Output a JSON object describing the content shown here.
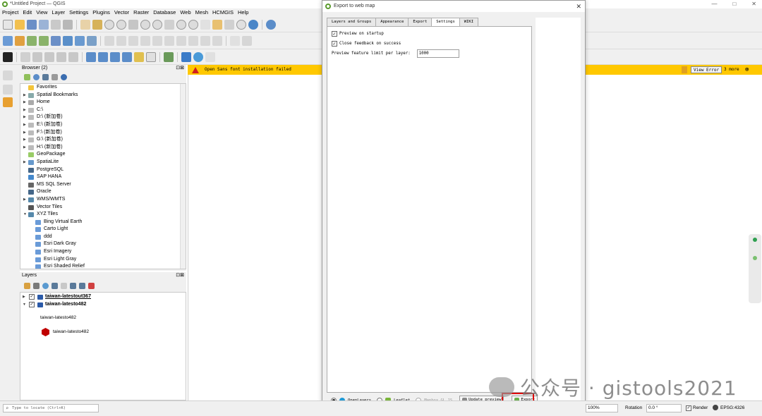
{
  "window": {
    "title": "*Untitled Project — QGIS",
    "controls": [
      "—",
      "□",
      "✕"
    ]
  },
  "menu": [
    "Project",
    "Edit",
    "View",
    "Layer",
    "Settings",
    "Plugins",
    "Vector",
    "Raster",
    "Database",
    "Web",
    "Mesh",
    "HCMGIS",
    "Help"
  ],
  "browser": {
    "title": "Browser (2)",
    "items": [
      {
        "label": "Favorites",
        "level": 0,
        "arrow": "",
        "color": "#f3c43a"
      },
      {
        "label": "Spatial Bookmarks",
        "level": 0,
        "arrow": "▶",
        "color": "#8aa"
      },
      {
        "label": "Home",
        "level": 0,
        "arrow": "▶",
        "color": "#aaa"
      },
      {
        "label": "C:\\",
        "level": 0,
        "arrow": "▶",
        "color": "#bbb"
      },
      {
        "label": "D:\\ (新加卷)",
        "level": 0,
        "arrow": "▶",
        "color": "#bbb"
      },
      {
        "label": "E:\\ (新加卷)",
        "level": 0,
        "arrow": "▶",
        "color": "#bbb"
      },
      {
        "label": "F:\\ (新加卷)",
        "level": 0,
        "arrow": "▶",
        "color": "#bbb"
      },
      {
        "label": "G:\\ (新加卷)",
        "level": 0,
        "arrow": "▶",
        "color": "#bbb"
      },
      {
        "label": "H:\\ (新加卷)",
        "level": 0,
        "arrow": "▶",
        "color": "#bbb"
      },
      {
        "label": "GeoPackage",
        "level": 0,
        "arrow": "",
        "color": "#9c6"
      },
      {
        "label": "SpatiaLite",
        "level": 0,
        "arrow": "▶",
        "color": "#69c"
      },
      {
        "label": "PostgreSQL",
        "level": 0,
        "arrow": "",
        "color": "#468"
      },
      {
        "label": "SAP HANA",
        "level": 0,
        "arrow": "",
        "color": "#48c"
      },
      {
        "label": "MS SQL Server",
        "level": 0,
        "arrow": "",
        "color": "#666"
      },
      {
        "label": "Oracle",
        "level": 0,
        "arrow": "",
        "color": "#468"
      },
      {
        "label": "WMS/WMTS",
        "level": 0,
        "arrow": "▶",
        "color": "#58a"
      },
      {
        "label": "Vector Tiles",
        "level": 0,
        "arrow": "",
        "color": "#555"
      },
      {
        "label": "XYZ Tiles",
        "level": 0,
        "arrow": "▼",
        "color": "#58a"
      },
      {
        "label": "Bing Virtual Earth",
        "level": 1,
        "arrow": "",
        "color": "#6a9bd8"
      },
      {
        "label": "Carto Light",
        "level": 1,
        "arrow": "",
        "color": "#6a9bd8"
      },
      {
        "label": "ddd",
        "level": 1,
        "arrow": "",
        "color": "#6a9bd8"
      },
      {
        "label": "Esri Dark Gray",
        "level": 1,
        "arrow": "",
        "color": "#6a9bd8"
      },
      {
        "label": "Esri Imagery",
        "level": 1,
        "arrow": "",
        "color": "#6a9bd8"
      },
      {
        "label": "Esri Light Gray",
        "level": 1,
        "arrow": "",
        "color": "#6a9bd8"
      },
      {
        "label": "Esri Shaded Relief",
        "level": 1,
        "arrow": "",
        "color": "#6a9bd8"
      }
    ]
  },
  "layers": {
    "title": "Layers",
    "items": [
      {
        "label": "taiwan-latestout367",
        "arrow": "▶",
        "bold": true
      },
      {
        "label": "taiwan-latesto482",
        "arrow": "▼",
        "bold": true
      }
    ],
    "legend_title": "taiwan-latesto482",
    "legend_item": "taiwan-latesto482"
  },
  "message": {
    "text": "Open Sans font installation failed",
    "button": "View Error",
    "more": "3 more"
  },
  "dialog": {
    "title": "Export to web map",
    "tabs": [
      "Layers and Groups",
      "Appearance",
      "Export",
      "Settings",
      "WIKI"
    ],
    "active_tab": 3,
    "settings": {
      "preview_on_startup": "Preview on startup",
      "close_feedback": "Close feedback on success",
      "preview_limit_label": "Preview feature limit per layer:",
      "preview_limit_value": "1000"
    },
    "renderers": [
      "OpenLayers",
      "Leaflet",
      "Mapbox GL JS"
    ],
    "selected_renderer": "OpenLayers",
    "update_preview": "Update preview",
    "export": "Export"
  },
  "status": {
    "locate_placeholder": "Type to locate (Ctrl+K)",
    "magnifier": "100%",
    "rotation_label": "Rotation",
    "rotation_value": "0.0 °",
    "render_label": "Render",
    "crs": "EPSG:4326"
  },
  "watermark": "公众号 · gistools2021",
  "colors": {
    "message_bar": "#ffc800",
    "highlight": "#e00000",
    "accent": "#5a9a2c"
  }
}
